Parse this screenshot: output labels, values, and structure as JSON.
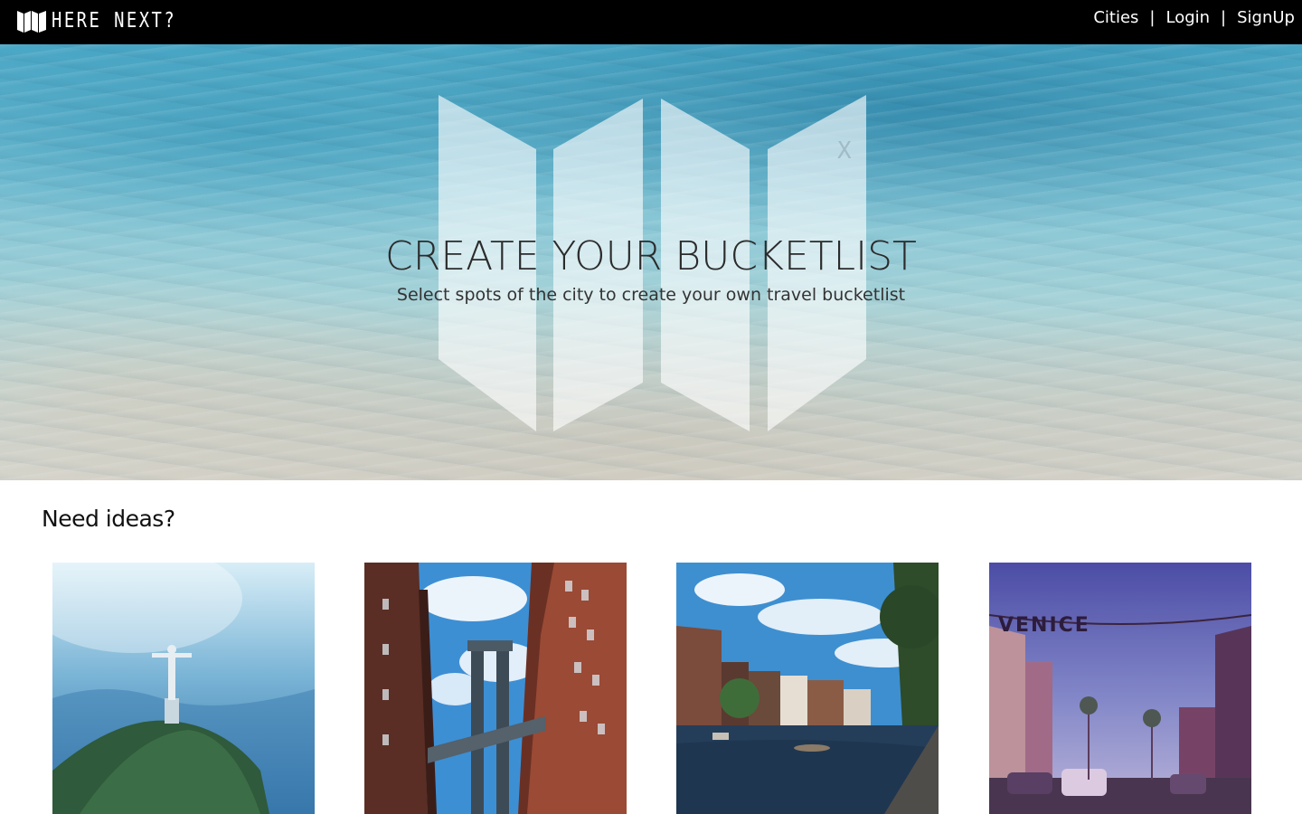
{
  "brand": {
    "name": "HERE NEXT?"
  },
  "nav": {
    "items": [
      "Cities",
      "Login",
      "SignUp"
    ],
    "separator": "|"
  },
  "hero": {
    "title": "CREATE YOUR BUCKETLIST",
    "subtitle": "Select spots of the city to create your own travel bucketlist",
    "logo_icon": "folded-map-icon"
  },
  "ideas": {
    "heading": "Need ideas?",
    "cards": [
      {
        "icon": "christ-the-redeemer-photo"
      },
      {
        "icon": "manhattan-bridge-photo"
      },
      {
        "icon": "amsterdam-canal-photo"
      },
      {
        "icon": "venice-sign-photo",
        "sign_text": "VENICE"
      }
    ]
  },
  "colors": {
    "topbar": "#000000",
    "hero_water": "#78c0d4",
    "hero_title": "#2b2b2b"
  }
}
